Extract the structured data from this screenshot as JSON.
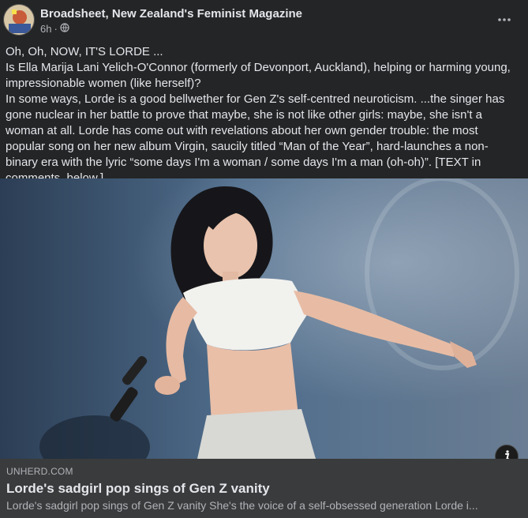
{
  "post": {
    "page_name": "Broadsheet, New Zealand's Feminist Magazine",
    "timestamp": "6h",
    "separator": "·",
    "privacy_icon": "globe-icon",
    "more_icon": "more-horizontal-icon",
    "text": [
      "Oh, Oh, NOW, IT'S LORDE ...",
      "Is Ella Marija Lani Yelich-O'Connor (formerly of Devonport, Auckland), helping or harming young, impressionable women (like herself)?",
      "In some ways, Lorde is a good bellwether for Gen Z's self-centred neuroticism. ...the singer has gone nuclear in her battle to prove that maybe, she is not like other girls: maybe, she isn't a woman at all. Lorde has come out with revelations about her own gender trouble: the most popular song on her new album Virgin, saucily titled “Man of the Year”, hard-launches a non-binary era with the lyric “some days I'm a woman / some days I'm a man (oh-oh)”. [TEXT in comments, below.]"
    ]
  },
  "link_preview": {
    "domain": "UNHERD.COM",
    "title": "Lorde's sadgirl pop sings of Gen Z vanity",
    "description": "Lorde's sadgirl pop sings of Gen Z vanity She's the voice of a self-obsessed generation Lorde i...",
    "info_icon": "info-icon"
  },
  "colors": {
    "background": "#242526",
    "card": "#3a3b3c",
    "primary_text": "#e4e6eb",
    "secondary_text": "#b0b3b8"
  }
}
